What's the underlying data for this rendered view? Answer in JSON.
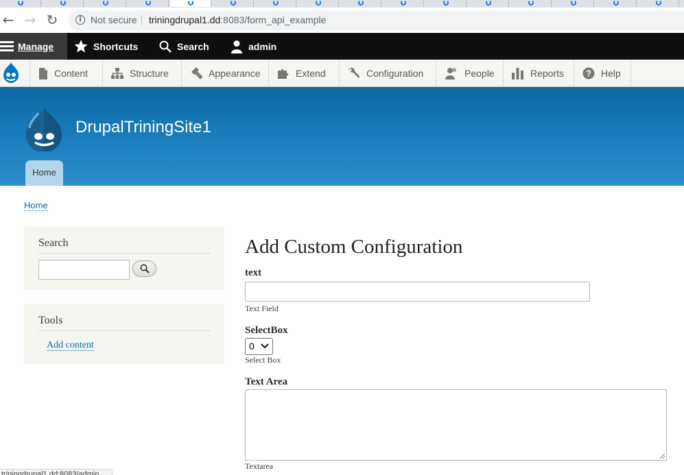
{
  "browser": {
    "security_label": "Not secure",
    "url_host": "triningdrupal1.dd",
    "url_path": ":8083/form_api_example",
    "status_url": "triningdrupal1.dd:8083/admin"
  },
  "toolbar": {
    "manage": "Manage",
    "shortcuts": "Shortcuts",
    "search": "Search",
    "user": "admin"
  },
  "tray": {
    "items": [
      {
        "label": "Content",
        "icon": "file-icon"
      },
      {
        "label": "Structure",
        "icon": "sitemap-icon"
      },
      {
        "label": "Appearance",
        "icon": "paintbrush-icon"
      },
      {
        "label": "Extend",
        "icon": "puzzle-icon"
      },
      {
        "label": "Configuration",
        "icon": "wrench-icon"
      },
      {
        "label": "People",
        "icon": "people-icon"
      },
      {
        "label": "Reports",
        "icon": "bar-chart-icon"
      },
      {
        "label": "Help",
        "icon": "help-icon"
      }
    ]
  },
  "header": {
    "site_name": "DrupalTriningSite1",
    "nav_home": "Home"
  },
  "breadcrumb": {
    "home": "Home"
  },
  "sidebar": {
    "search_title": "Search",
    "tools_title": "Tools",
    "tools_link": "Add content"
  },
  "form": {
    "title": "Add Custom Configuration",
    "text_label": "text",
    "text_desc": "Text Field",
    "select_label": "SelectBox",
    "select_value": "0",
    "select_desc": "Select Box",
    "textarea_label": "Text Area",
    "textarea_desc": "Textarea"
  },
  "colors": {
    "header_blue": "#0d67a2",
    "link": "#0071b3",
    "toolbar_black": "#0f0f0f"
  }
}
